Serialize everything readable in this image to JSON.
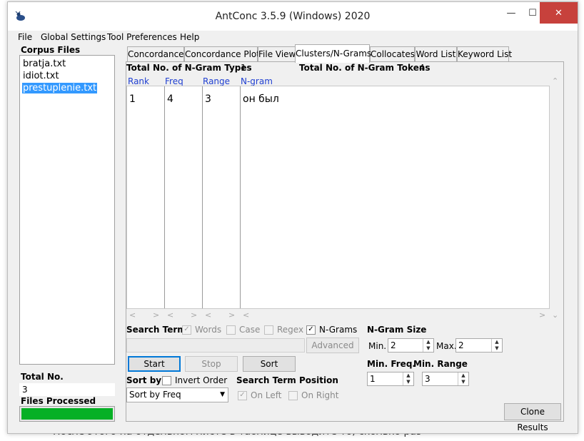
{
  "app": {
    "title": "AntConc 3.5.9 (Windows) 2020",
    "window_controls": {
      "minimize": "—",
      "maximize": "☐",
      "close": "✕"
    }
  },
  "background_doc": {
    "visible_line": "После этого на отдельном листе в таблице выводите то, сколько раз"
  },
  "menu": {
    "file": "File",
    "global": "Global Settings",
    "tool": "Tool Preferences",
    "help": "Help"
  },
  "sidebar": {
    "corpus_label": "Corpus Files",
    "files": [
      "bratja.txt",
      "idiot.txt",
      "prestuplenie.txt"
    ],
    "selected_index": 2,
    "total_label": "Total No.",
    "total_value": "3",
    "processed_label": "Files Processed",
    "progress": 1.0
  },
  "tabs": [
    "Concordance",
    "Concordance Plot",
    "File View",
    "Clusters/N-Grams",
    "Collocates",
    "Word List",
    "Keyword List"
  ],
  "active_tab": "Clusters/N-Grams",
  "stats": {
    "types_label": "Total No. of N-Gram Types",
    "types_value": "1",
    "tokens_label": "Total No. of N-Gram Tokens",
    "tokens_value": "4"
  },
  "table": {
    "headers": [
      "Rank",
      "Freq",
      "Range",
      "N-gram"
    ],
    "rows": [
      [
        "1",
        "4",
        "3",
        "он был"
      ]
    ]
  },
  "search": {
    "label": "Search Term",
    "words_label": "Words",
    "case_label": "Case",
    "regex_label": "Regex",
    "ngrams_label": "N-Grams",
    "words_checked": true,
    "case_checked": false,
    "regex_checked": false,
    "ngrams_checked": true,
    "term_value": "",
    "advanced_label": "Advanced"
  },
  "buttons": {
    "start": "Start",
    "stop": "Stop",
    "sort": "Sort",
    "clone": "Clone Results"
  },
  "sort": {
    "label": "Sort by",
    "invert_label": "Invert Order",
    "selected": "Sort by Freq"
  },
  "position": {
    "label": "Search Term Position",
    "on_left": "On Left",
    "on_right": "On Right",
    "on_left_checked": true,
    "on_right_checked": false
  },
  "ngram_size": {
    "label": "N-Gram Size",
    "min_label": "Min.",
    "min_value": "2",
    "max_label": "Max.",
    "max_value": "2"
  },
  "min_freq": {
    "label": "Min. Freq.",
    "value": "1"
  },
  "min_range": {
    "label": "Min. Range",
    "value": "3"
  },
  "colors": {
    "accent": "#3399ff",
    "progress": "#06b025",
    "header_text": "#1f3fd1",
    "close_button": "#c7413c"
  }
}
